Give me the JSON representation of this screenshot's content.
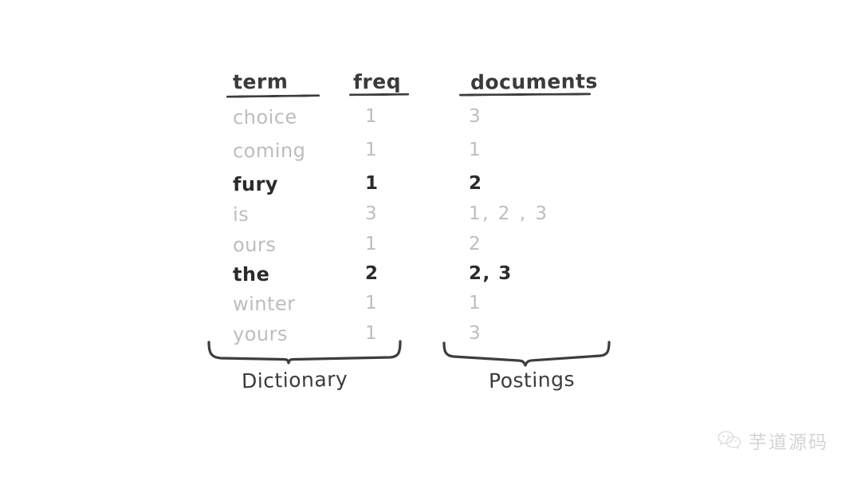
{
  "figure": {
    "title": "inverted-index-dictionary-postings",
    "background": "#ffffff",
    "ink_dark": "#2b2b2b",
    "ink_light": "#bdbdbd"
  },
  "table": {
    "headers": {
      "term": "term",
      "freq": "freq",
      "documents": "documents"
    },
    "rows": [
      {
        "term": "choice",
        "freq": "1",
        "documents": "3",
        "emphasis": "light"
      },
      {
        "term": "coming",
        "freq": "1",
        "documents": "1",
        "emphasis": "light"
      },
      {
        "term": "fury",
        "freq": "1",
        "documents": "2",
        "emphasis": "dark"
      },
      {
        "term": "is",
        "freq": "3",
        "documents": "1, 2 , 3",
        "emphasis": "light"
      },
      {
        "term": "ours",
        "freq": "1",
        "documents": "2",
        "emphasis": "light"
      },
      {
        "term": "the",
        "freq": "2",
        "documents": "2, 3",
        "emphasis": "dark"
      },
      {
        "term": "winter",
        "freq": "1",
        "documents": "1",
        "emphasis": "light"
      },
      {
        "term": "yours",
        "freq": "1",
        "documents": "3",
        "emphasis": "light"
      }
    ]
  },
  "braces": {
    "dictionary_label": "Dictionary",
    "postings_label": "Postings"
  },
  "watermark": {
    "icon": "wechat-icon",
    "text": "芋道源码",
    "color": "#d2d2d2"
  }
}
